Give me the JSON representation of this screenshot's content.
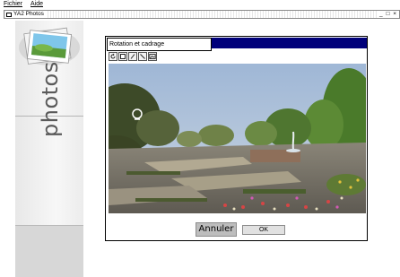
{
  "menu": {
    "file": "Fichier",
    "help": "Aide"
  },
  "window": {
    "title": "YA2 Photos",
    "controls": "_ □ ×"
  },
  "sidebar": {
    "title": "photos"
  },
  "dialog": {
    "title": "Rotation et cadrage",
    "tools": [
      "rotate-icon",
      "crop-icon",
      "pen-icon",
      "line-icon",
      "image-icon"
    ],
    "cancel_label": "Annuler",
    "ok_label": "OK"
  },
  "colors": {
    "title_bar_blue": "#00007a",
    "sidebar_grey": "#d7d7d7"
  }
}
